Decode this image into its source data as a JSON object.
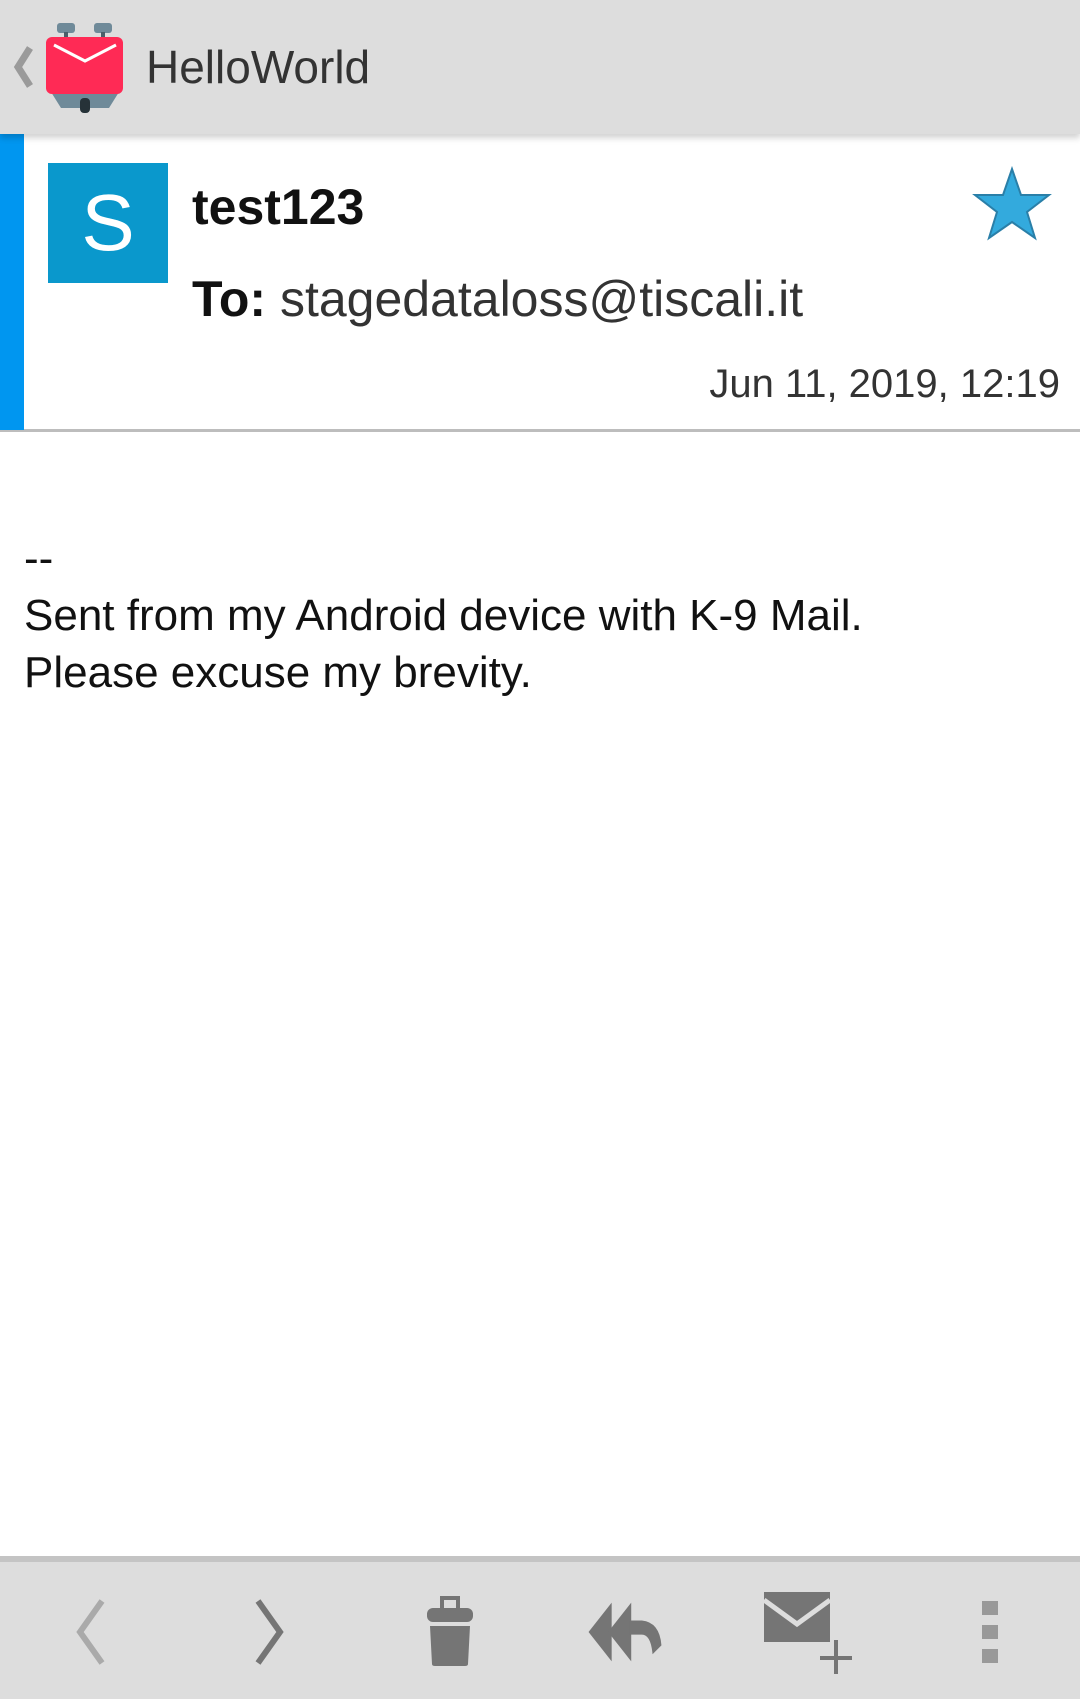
{
  "app_bar": {
    "title": "HelloWorld",
    "back_icon": "chevron-left-icon",
    "logo_icon": "k9-mail-logo"
  },
  "message": {
    "avatar_letter": "S",
    "sender": "test123",
    "to_label": "To:",
    "to_address": "stagedataloss@tiscali.it",
    "date": "Jun 11, 2019, 12:19",
    "starred": true,
    "body_lines": [
      "--",
      "Sent from my Android device with K-9 Mail.",
      "Please excuse my brevity."
    ]
  },
  "colors": {
    "accent": "#0096f0",
    "avatar": "#0a98cc",
    "star": "#33aadd",
    "logo": "#ff2a55"
  },
  "bottom_bar": [
    "previous",
    "next",
    "delete",
    "reply-all",
    "compose",
    "more"
  ]
}
